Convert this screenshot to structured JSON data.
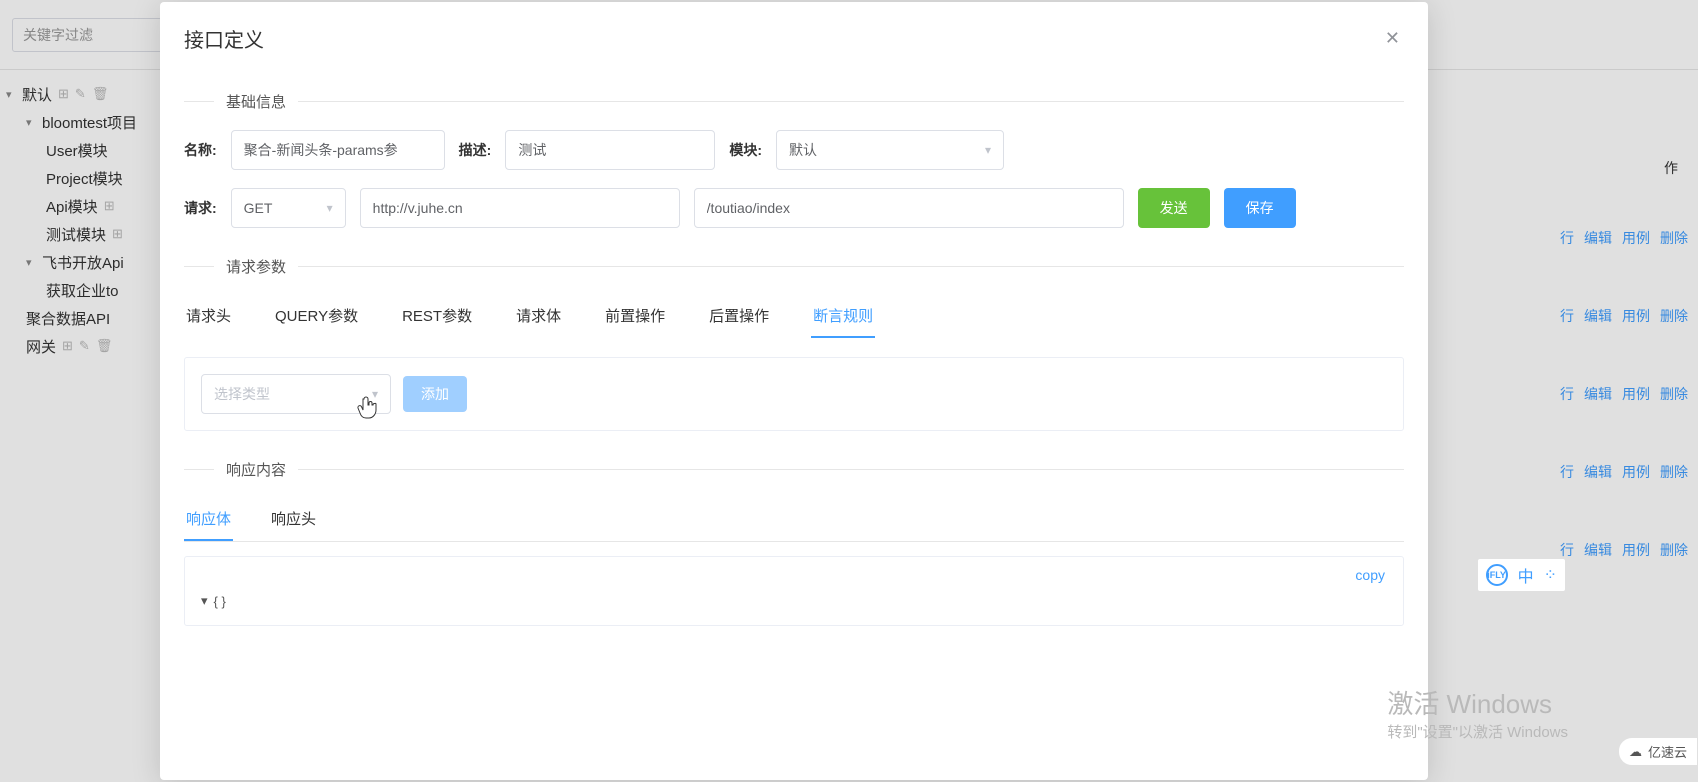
{
  "filter_placeholder": "关键字过滤",
  "tree": {
    "root": "默认",
    "project": "bloomtest项目",
    "user_mod": "User模块",
    "project_mod": "Project模块",
    "api_mod": "Api模块",
    "test_mod": "测试模块",
    "feishu": "飞书开放Api",
    "feishu_token": "获取企业to",
    "juhe": "聚合数据API",
    "gateway": "网关"
  },
  "bg_actions": {
    "op": "作",
    "run": "行",
    "edit": "编辑",
    "case": "用例",
    "del": "删除"
  },
  "modal": {
    "title": "接口定义",
    "section_basic": "基础信息",
    "label_name": "名称:",
    "name_value": "聚合-新闻头条-params参",
    "label_desc": "描述:",
    "desc_value": "测试",
    "label_module": "模块:",
    "module_value": "默认",
    "label_request": "请求:",
    "method_value": "GET",
    "host_value": "http://v.juhe.cn",
    "path_value": "/toutiao/index",
    "btn_send": "发送",
    "btn_save": "保存",
    "section_params": "请求参数",
    "tabs": {
      "headers": "请求头",
      "query": "QUERY参数",
      "rest": "REST参数",
      "body": "请求体",
      "pre": "前置操作",
      "post": "后置操作",
      "assert": "断言规则"
    },
    "type_placeholder": "选择类型",
    "btn_add": "添加",
    "section_resp": "响应内容",
    "sub_tabs": {
      "body": "响应体",
      "headers": "响应头"
    },
    "copy": "copy",
    "json_empty": "{ }"
  },
  "watermark": {
    "l1": "激活 Windows",
    "l2": "转到\"设置\"以激活 Windows"
  },
  "ime": {
    "brand": "iFLY",
    "lang": "中"
  },
  "cloud_badge": "亿速云"
}
